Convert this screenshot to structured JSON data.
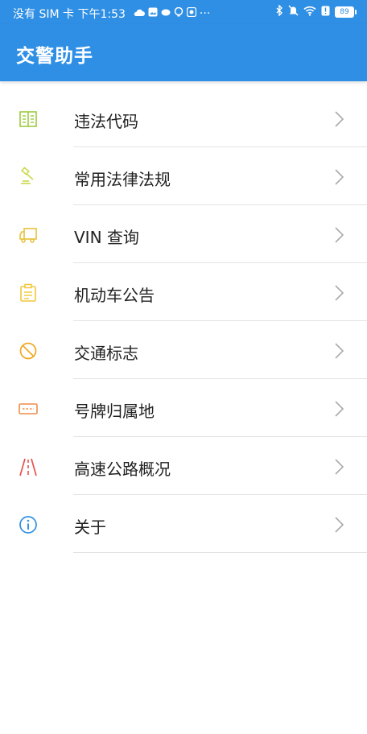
{
  "statusbar": {
    "left_text": "没有 SIM 卡 下午1:53",
    "more": "···",
    "battery": "89"
  },
  "appbar": {
    "title": "交警助手"
  },
  "menu": [
    {
      "label": "违法代码",
      "icon": "book-icon",
      "color": "#9ccb3c"
    },
    {
      "label": "常用法律法规",
      "icon": "gavel-icon",
      "color": "#c9d94a"
    },
    {
      "label": "VIN 查询",
      "icon": "truck-icon",
      "color": "#e7c23a"
    },
    {
      "label": "机动车公告",
      "icon": "clipboard-icon",
      "color": "#f2c73b"
    },
    {
      "label": "交通标志",
      "icon": "no-entry-icon",
      "color": "#f0a823"
    },
    {
      "label": "号牌归属地",
      "icon": "license-plate-icon",
      "color": "#ef8c4a"
    },
    {
      "label": "高速公路概况",
      "icon": "highway-icon",
      "color": "#e6524d"
    },
    {
      "label": "关于",
      "icon": "info-icon",
      "color": "#2f8fe4"
    }
  ]
}
